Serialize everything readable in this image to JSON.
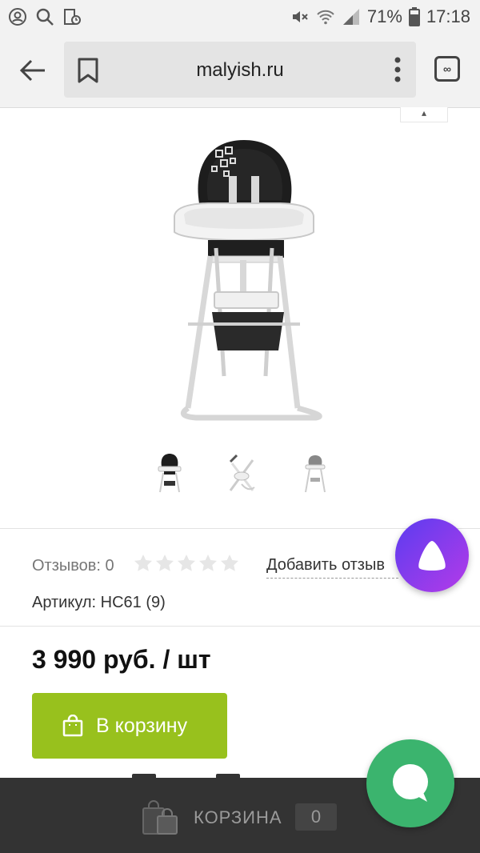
{
  "status_bar": {
    "battery_percent": "71%",
    "time": "17:18",
    "icons": [
      "account-circle-icon",
      "search-icon",
      "screenshot-icon",
      "mute-icon",
      "wifi-icon",
      "signal-icon",
      "battery-icon"
    ]
  },
  "browser": {
    "url": "malyish.ru",
    "tabs_icon_label": "∞"
  },
  "product": {
    "thumbnails": [
      {
        "name": "thumb-1",
        "active": true
      },
      {
        "name": "thumb-2",
        "active": false
      },
      {
        "name": "thumb-3",
        "active": false
      }
    ],
    "reviews_label": "Отзывов: 0",
    "rating_stars": 0,
    "rating_max": 5,
    "add_review_label": "Добавить отзыв",
    "sku_label": "Артикул: HC61 (9)",
    "price": "3 990 руб. / шт",
    "add_to_cart_label": "В корзину"
  },
  "bottom_bar": {
    "cart_label": "КОРЗИНА",
    "cart_count": "0"
  },
  "colors": {
    "accent_green": "#98c11d",
    "chat_green": "#3bb46e",
    "alice_purple": "#7b3cec",
    "bottom_bar": "#333333"
  }
}
